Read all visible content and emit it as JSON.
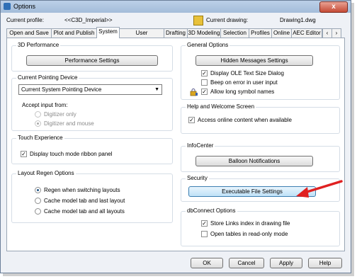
{
  "window": {
    "title": "Options",
    "close_glyph": "x"
  },
  "profile": {
    "label": "Current profile:",
    "value": "<<C3D_Imperial>>",
    "drawing_label": "Current drawing:",
    "drawing_value": "Drawing1.dwg"
  },
  "tabs": [
    "Open and Save",
    "Plot and Publish",
    "System",
    "User Preferences",
    "Drafting",
    "3D Modeling",
    "Selection",
    "Profiles",
    "Online",
    "AEC Editor"
  ],
  "active_tab": "System",
  "left": {
    "perf": {
      "title": "3D Performance",
      "button": "Performance Settings"
    },
    "pointing": {
      "title": "Current Pointing Device",
      "select_value": "Current System Pointing Device",
      "accept_label": "Accept input from:",
      "options": [
        "Digitizer only",
        "Digitizer and mouse"
      ]
    },
    "touch": {
      "title": "Touch Experience",
      "checkbox": "Display touch mode ribbon panel"
    },
    "regen": {
      "title": "Layout Regen Options",
      "options": [
        "Regen when switching layouts",
        "Cache model tab and last layout",
        "Cache model tab and all layouts"
      ]
    }
  },
  "right": {
    "general": {
      "title": "General Options",
      "button": "Hidden Messages Settings",
      "checks": [
        "Display OLE Text Size Dialog",
        "Beep on error in user input",
        "Allow long symbol names"
      ]
    },
    "help": {
      "title": "Help and Welcome Screen",
      "checkbox": "Access online content when available"
    },
    "infocenter": {
      "title": "InfoCenter",
      "button": "Balloon Notifications"
    },
    "security": {
      "title": "Security",
      "button": "Executable File Settings"
    },
    "dbconnect": {
      "title": "dbConnect Options",
      "checks": [
        "Store Links index in drawing file",
        "Open tables in read-only mode"
      ]
    }
  },
  "footer": {
    "ok": "OK",
    "cancel": "Cancel",
    "apply": "Apply",
    "help": "Help"
  },
  "colors": {
    "arrow": "#e02020",
    "title_bar": "#bcd0e8"
  }
}
